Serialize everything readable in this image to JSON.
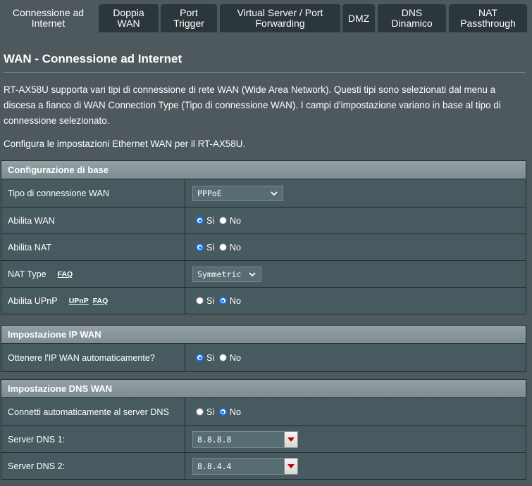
{
  "tabs": [
    {
      "label": "Connessione ad\nInternet",
      "active": true
    },
    {
      "label": "Doppia\nWAN"
    },
    {
      "label": "Port\nTrigger"
    },
    {
      "label": "Virtual Server / Port\nForwarding"
    },
    {
      "label": "DMZ"
    },
    {
      "label": "DNS\nDinamico"
    },
    {
      "label": "NAT\nPassthrough"
    }
  ],
  "page": {
    "title": "WAN - Connessione ad Internet",
    "description": "RT-AX58U supporta vari tipi di connessione di rete WAN (Wide Area Network). Questi tipi sono selezionati dal menu a discesa a fianco di WAN Connection Type (Tipo di connessione WAN). I campi d'impostazione variano in base al tipo di connessione selezionato.",
    "subdescription": "Configura le impostazioni Ethernet WAN per il RT-AX58U."
  },
  "basic": {
    "header": "Configurazione di base",
    "wan_type_label": "Tipo di connessione WAN",
    "wan_type_value": "PPPoE",
    "enable_wan_label": "Abilita WAN",
    "enable_nat_label": "Abilita NAT",
    "nat_type_label": "NAT Type",
    "nat_type_faq": "FAQ",
    "nat_type_value": "Symmetric",
    "upnp_label": "Abilita UPnP",
    "upnp_link": "UPnP",
    "upnp_faq": "FAQ"
  },
  "ip": {
    "header": "Impostazione IP WAN",
    "auto_ip_label": "Ottenere l'IP WAN automaticamente?"
  },
  "dns": {
    "header": "Impostazione DNS WAN",
    "auto_dns_label": "Connetti automaticamente al server DNS",
    "dns1_label": "Server DNS 1:",
    "dns1_value": "8.8.8.8",
    "dns2_label": "Server DNS 2:",
    "dns2_value": "8.8.4.4"
  },
  "radio": {
    "yes": "Sì",
    "no": "No"
  },
  "colors": {
    "accent": "#1a73e8",
    "page_bg": "#4d595d",
    "tab_bg": "#2b373b",
    "dropdown_arrow": "#b30000"
  }
}
